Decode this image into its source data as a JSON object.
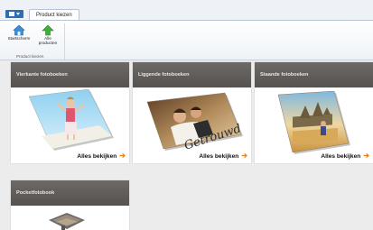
{
  "ribbon": {
    "tab_label": "Product kiezen",
    "buttons": [
      {
        "label": "Startscherm",
        "icon": "home-icon"
      },
      {
        "label": "Alle producten",
        "icon": "up-arrow-icon"
      }
    ],
    "group_label": "Product kiezen"
  },
  "cards": [
    {
      "title": "Vierkante fotoboeken",
      "link": "Alles bekijken"
    },
    {
      "title": "Liggende fotoboeken",
      "link": "Alles bekijken",
      "cover_text": "Getrouwd"
    },
    {
      "title": "Staande fotoboeken",
      "link": "Alles bekijken"
    },
    {
      "title": "Pocketfotobook",
      "link": ""
    }
  ],
  "colors": {
    "accent_arrow": "#f07c14",
    "header_bg": "#5f5c59",
    "app_button": "#2d6db4"
  }
}
